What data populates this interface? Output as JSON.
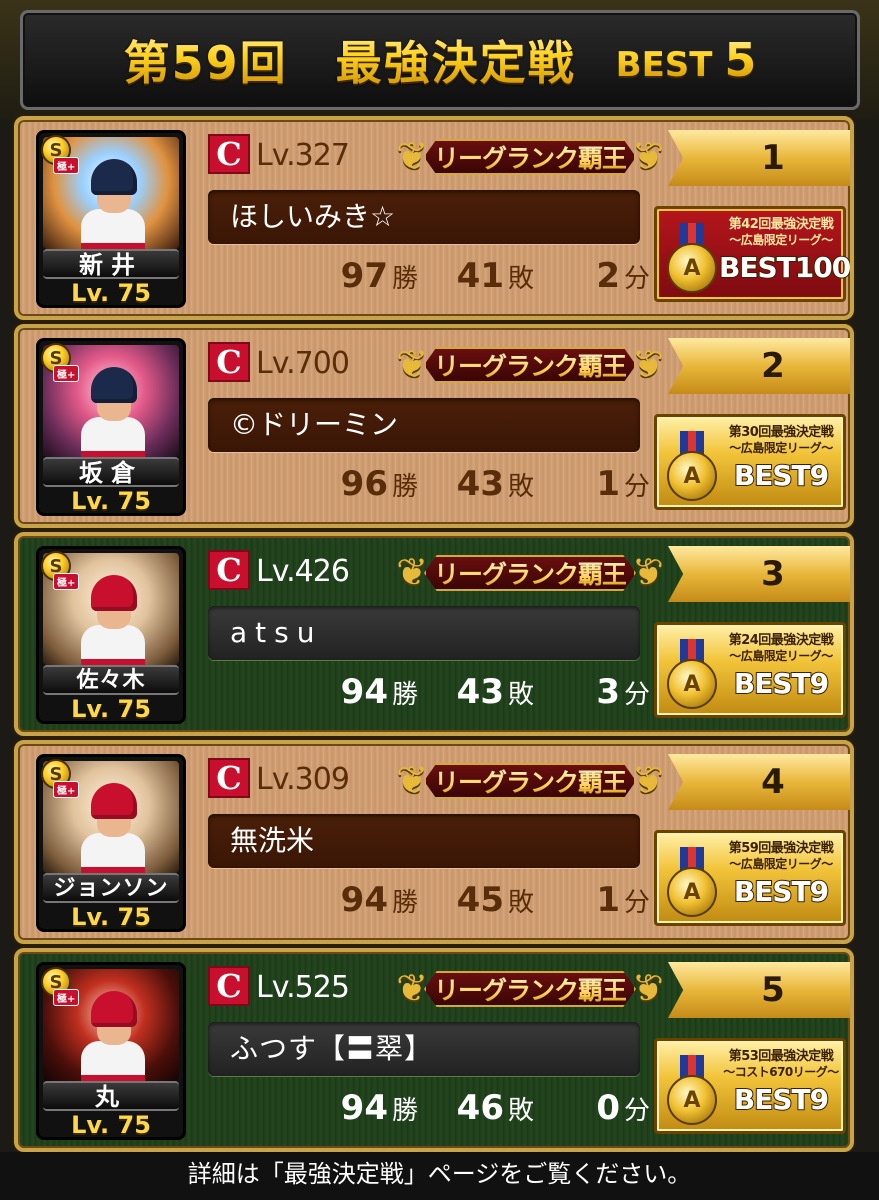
{
  "header": {
    "title": "第59回　最強決定戦",
    "best_prefix": "BEST",
    "best_number": "5"
  },
  "entries": [
    {
      "theme": "bronze",
      "card": {
        "rarity": "S",
        "rarity_tag": "極+",
        "name": "新井",
        "level": "Lv. 75"
      },
      "user": {
        "level": "Lv.327",
        "rank_title": "リーグランク覇王",
        "name": "ほしいみき☆"
      },
      "place": "1",
      "record": {
        "wins": "97",
        "wins_unit": "勝",
        "losses": "41",
        "losses_unit": "敗",
        "draws": "2",
        "draws_unit": "分"
      },
      "medal": {
        "title": "第42回最強決定戦",
        "subtitle": "～広島限定リーグ～",
        "best": "BEST100",
        "style": "red-frame"
      }
    },
    {
      "theme": "bronze",
      "card": {
        "rarity": "S",
        "rarity_tag": "極+",
        "name": "坂倉",
        "level": "Lv. 75"
      },
      "user": {
        "level": "Lv.700",
        "rank_title": "リーグランク覇王",
        "name": "©ドリーミン"
      },
      "place": "2",
      "record": {
        "wins": "96",
        "wins_unit": "勝",
        "losses": "43",
        "losses_unit": "敗",
        "draws": "1",
        "draws_unit": "分"
      },
      "medal": {
        "title": "第30回最強決定戦",
        "subtitle": "～広島限定リーグ～",
        "best": "BEST9",
        "style": "gold"
      }
    },
    {
      "theme": "green",
      "card": {
        "rarity": "S",
        "rarity_tag": "極+",
        "name": "佐々木",
        "level": "Lv. 75"
      },
      "user": {
        "level": "Lv.426",
        "rank_title": "リーグランク覇王",
        "name": "atsu"
      },
      "place": "3",
      "record": {
        "wins": "94",
        "wins_unit": "勝",
        "losses": "43",
        "losses_unit": "敗",
        "draws": "3",
        "draws_unit": "分"
      },
      "medal": {
        "title": "第24回最強決定戦",
        "subtitle": "～広島限定リーグ～",
        "best": "BEST9",
        "style": "gold"
      }
    },
    {
      "theme": "bronze",
      "card": {
        "rarity": "S",
        "rarity_tag": "極+",
        "name": "ジョンソン",
        "level": "Lv. 75"
      },
      "user": {
        "level": "Lv.309",
        "rank_title": "リーグランク覇王",
        "name": "無洗米"
      },
      "place": "4",
      "record": {
        "wins": "94",
        "wins_unit": "勝",
        "losses": "45",
        "losses_unit": "敗",
        "draws": "1",
        "draws_unit": "分"
      },
      "medal": {
        "title": "第59回最強決定戦",
        "subtitle": "～広島限定リーグ～",
        "best": "BEST9",
        "style": "gold"
      }
    },
    {
      "theme": "green",
      "card": {
        "rarity": "S",
        "rarity_tag": "極+",
        "name": "丸",
        "level": "Lv. 75"
      },
      "user": {
        "level": "Lv.525",
        "rank_title": "リーグランク覇王",
        "name": "ふつす【〓翠】"
      },
      "place": "5",
      "record": {
        "wins": "94",
        "wins_unit": "勝",
        "losses": "46",
        "losses_unit": "敗",
        "draws": "0",
        "draws_unit": "分"
      },
      "medal": {
        "title": "第53回最強決定戦",
        "subtitle": "～コスト670リーグ～",
        "best": "BEST9",
        "style": "gold"
      }
    }
  ],
  "footer": {
    "text": "詳細は「最強決定戦」ページをご覧ください。"
  },
  "colors": {
    "gold": "#ffd84a",
    "carp_red": "#c8102e",
    "bronze_panel": "#cf9c70",
    "green_panel": "#214420"
  }
}
